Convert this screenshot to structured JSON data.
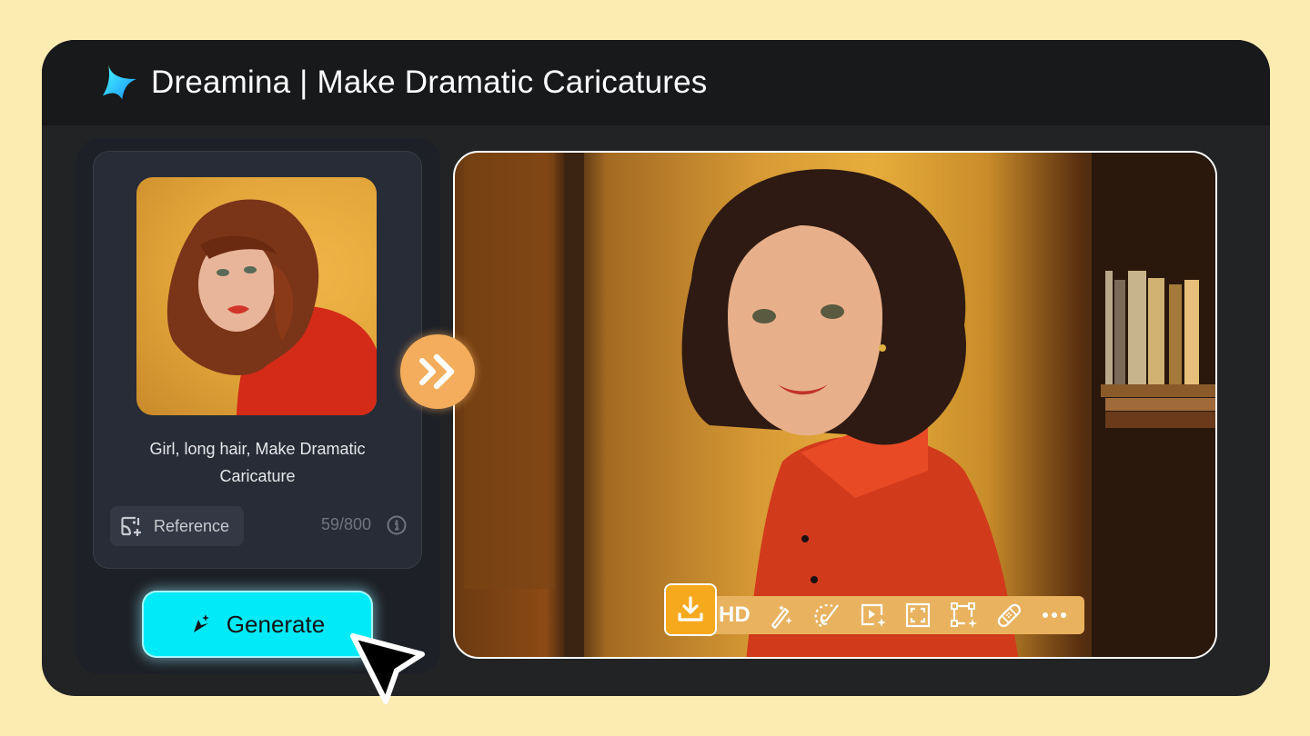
{
  "header": {
    "title": "Dreamina | Make Dramatic Caricatures",
    "logo_icon": "dreamina-star-logo"
  },
  "input_panel": {
    "reference_image_alt": "Photo of a girl with curly auburn hair in a red sweater against a yellow background",
    "prompt": "Girl, long hair, Make Dramatic Caricature",
    "reference_button_label": "Reference",
    "reference_icon": "image-add-icon",
    "char_count": "59/800",
    "info_icon": "info-icon"
  },
  "generate_button": {
    "label": "Generate",
    "icon": "sparkle-wand-icon"
  },
  "arrow_button": {
    "icon": "double-chevron-right-icon"
  },
  "result": {
    "image_alt": "Painted caricature of a girl with dark bob hair in a red coat, in front of a bookshelf",
    "toolbar": {
      "download_icon": "download-icon",
      "hd_label": "HD",
      "tools": [
        "magic-wand-icon",
        "inpaint-brush-icon",
        "image-to-video-icon",
        "expand-icon",
        "resize-icon",
        "remove-bandage-icon",
        "more-icon"
      ]
    }
  },
  "colors": {
    "background": "#fdecb1",
    "frame": "#222325",
    "header": "#18191b",
    "accent_cyan": "#00eaf7",
    "accent_orange": "#f3ad5c",
    "download_orange": "#f7a91e",
    "toolbar": "#e8b25f"
  }
}
